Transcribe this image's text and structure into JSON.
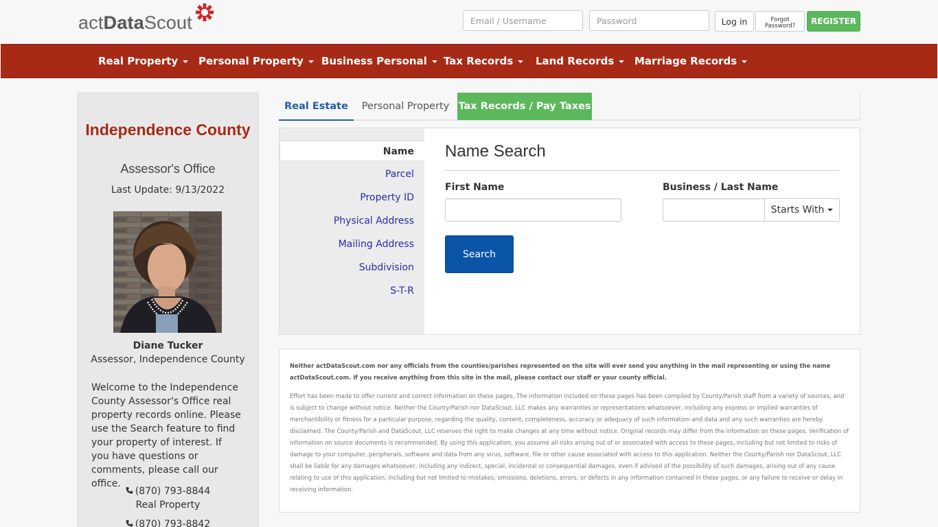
{
  "brand": {
    "logo_prefix": "act",
    "logo_bold": "Data",
    "logo_suffix": "Scout",
    "accent": "#a62a16"
  },
  "login": {
    "email_placeholder": "Email / Username",
    "password_placeholder": "Password",
    "login_label": "Log in",
    "forgot_line1": "Forgot",
    "forgot_line2": "Password?",
    "register_label": "REGISTER"
  },
  "nav": {
    "items": [
      {
        "label": "Real Property"
      },
      {
        "label": "Personal Property"
      },
      {
        "label": "Business Personal"
      },
      {
        "label": "Tax Records"
      },
      {
        "label": "Land Records"
      },
      {
        "label": "Marriage Records"
      }
    ]
  },
  "sidebar": {
    "county": "Independence County",
    "office": "Assessor's Office",
    "last_update": "Last Update: 9/13/2022",
    "assessor_name": "Diane Tucker",
    "assessor_title": "Assessor, Independence County",
    "welcome": "Welcome to the Independence County Assessor's Office real property records online. Please use the Search feature to find your property of interest. If you have questions or comments, please call our office.",
    "contacts": [
      {
        "phone": "(870) 793-8844",
        "dept": "Real Property"
      },
      {
        "phone": "(870) 793-8842",
        "dept": ""
      }
    ]
  },
  "tabs": [
    {
      "label": "Real Estate"
    },
    {
      "label": "Personal Property"
    },
    {
      "label": "Tax Records / Pay Taxes"
    }
  ],
  "search": {
    "menu": [
      {
        "label": "Name"
      },
      {
        "label": "Parcel"
      },
      {
        "label": "Property ID"
      },
      {
        "label": "Physical Address"
      },
      {
        "label": "Mailing Address"
      },
      {
        "label": "Subdivision"
      },
      {
        "label": "S-T-R"
      }
    ],
    "title": "Name Search",
    "first_name_label": "First Name",
    "first_name_value": "",
    "last_name_label": "Business / Last Name",
    "last_name_value": "",
    "match_mode": "Starts With",
    "search_label": "Search"
  },
  "disclaimer": {
    "notice": "Neither actDataScout.com nor any officials from the counties/parishes represented on the site will ever send you anything in the mail representing or using the name actDataScout.com. If you receive anything from this site in the mail, please contact our staff or your county official.",
    "body": "Effort has been made to offer current and correct information on these pages. The information included on these pages has been compiled by County/Parish staff from a variety of sources, and is subject to change without notice. Neither the County/Parish nor DataScout, LLC makes any warranties or representations whatsoever, including any express or implied warranties of merchantibility or fitness for a particular purpose, regarding the quality, content, completeness, accuracy or adequacy of such information and data and any such warranties are hereby disclaimed. The County/Parish and DataScout, LLC reserves the right to make changes at any time without notice. Original records may differ from the information on these pages. Verification of information on source documents is recommended. By using this application, you assume all risks arising out of or associated with access to these pages, including but not limited to risks of damage to your computer, peripherals, software and data from any virus, software, file or other cause associated with access to this application. Neither the County/Parish nor DataScout, LLC shall be liable for any damages whatsoever, including any indirect, special, incidental or consequential damages, even if advised of the possibility of such damages, arising out of any cause relating to use of this application, including but not limited to mistakes, omissions, deletions, errors, or defects in any information contained in these pages, or any failure to receive or delay in receiving information."
  }
}
